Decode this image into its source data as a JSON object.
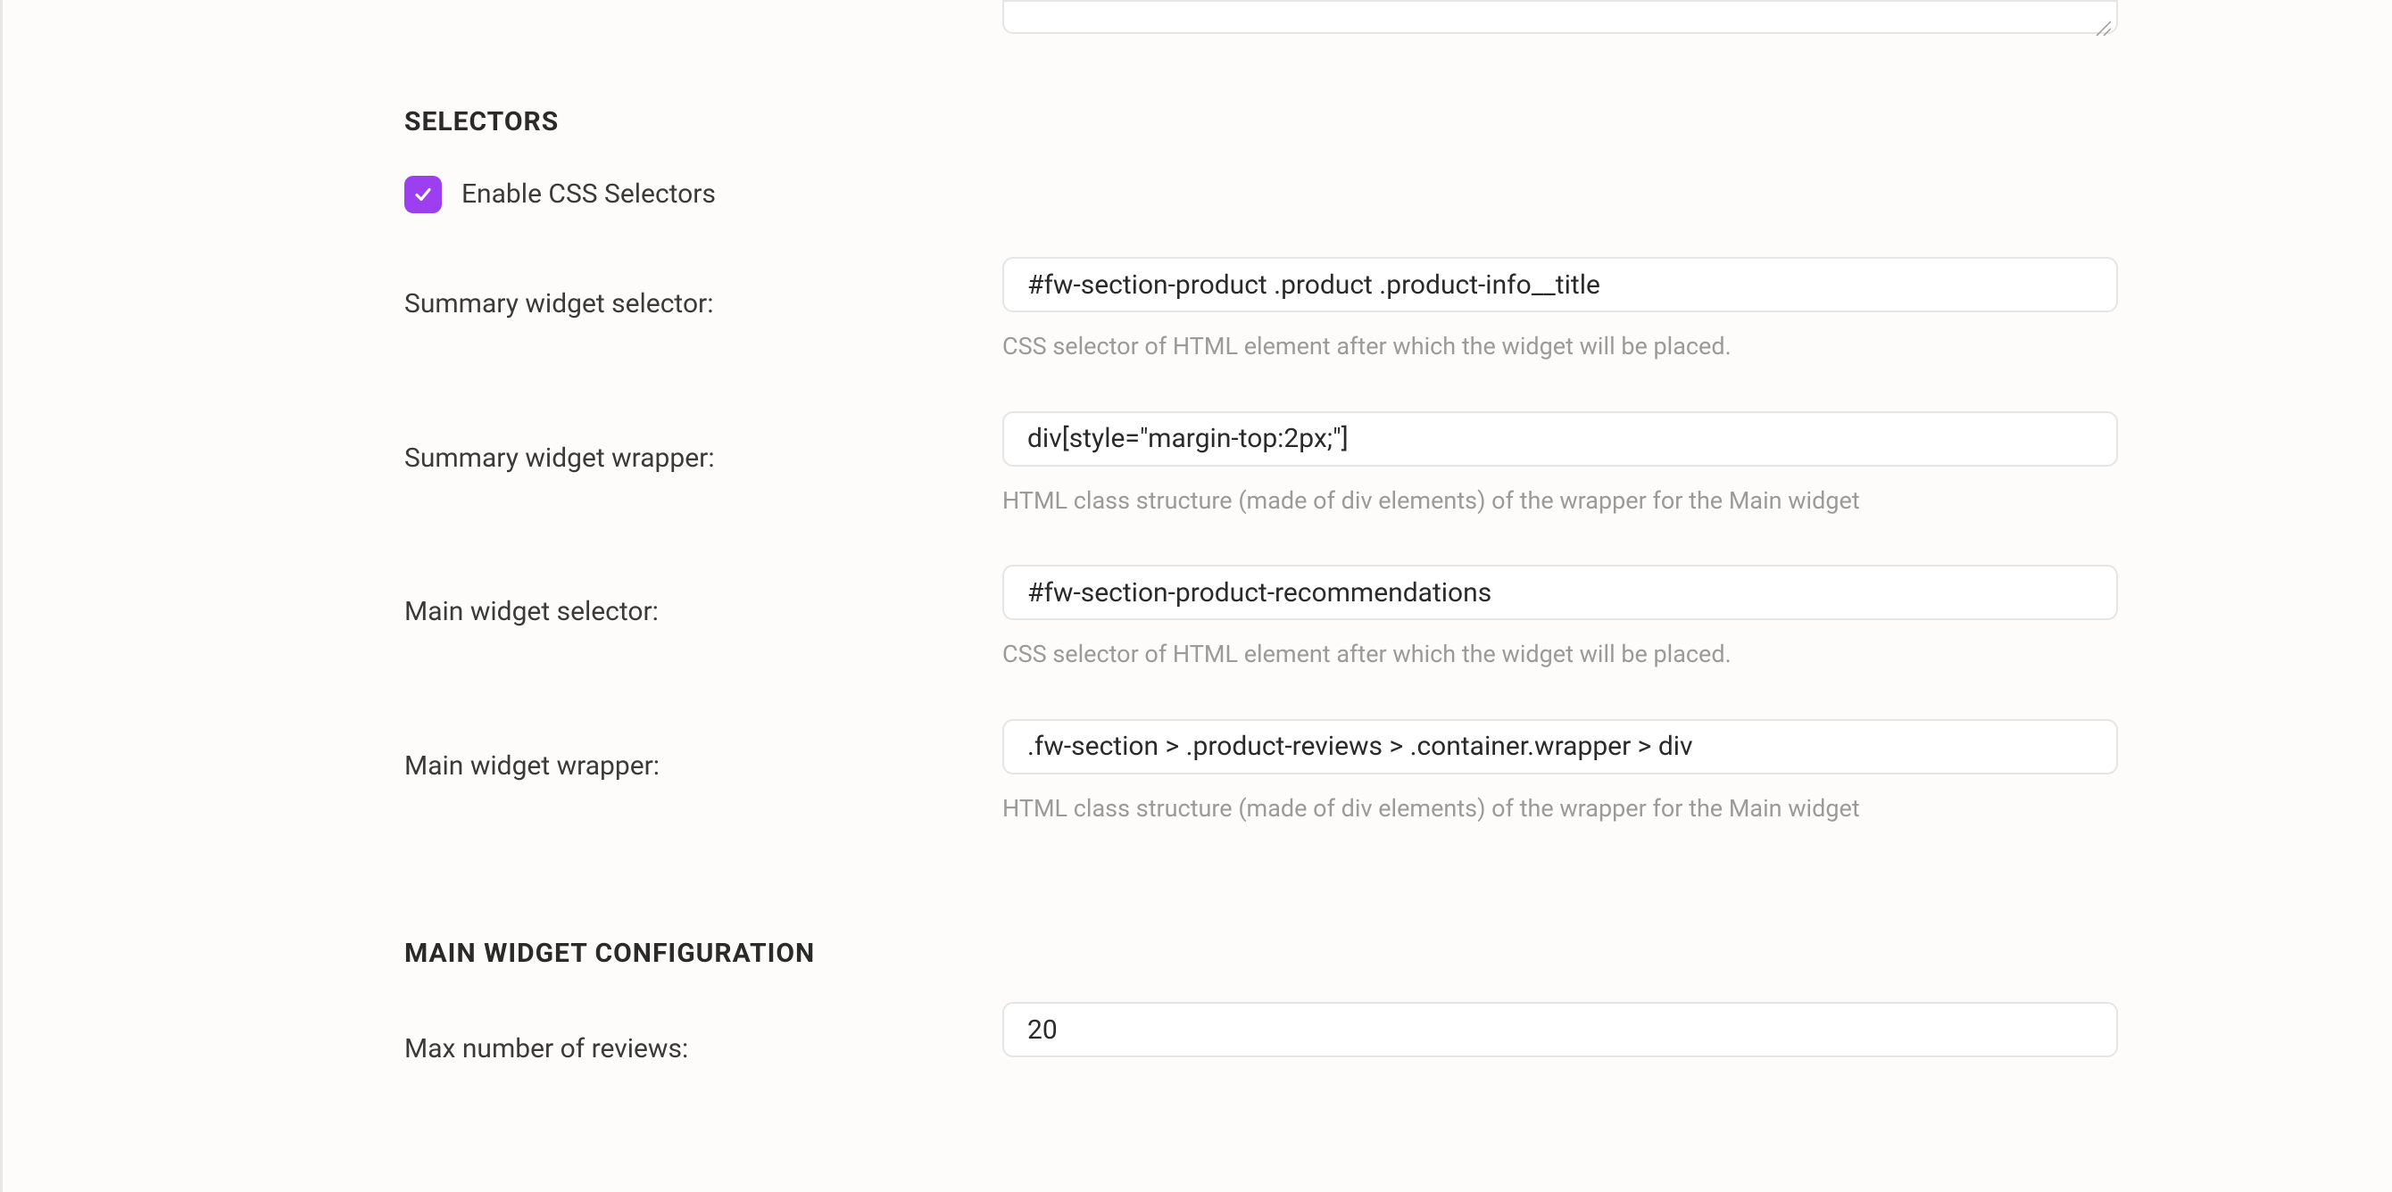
{
  "sections": {
    "selectors": {
      "heading": "SELECTORS",
      "enable_checkbox": {
        "label": "Enable CSS Selectors",
        "checked": true
      },
      "fields": {
        "summary_widget_selector": {
          "label": "Summary widget selector:",
          "value": "#fw-section-product .product .product-info__title",
          "help": "CSS selector of HTML element after which the widget will be placed."
        },
        "summary_widget_wrapper": {
          "label": "Summary widget wrapper:",
          "value": "div[style=\"margin-top:2px;\"]",
          "help": "HTML class structure (made of div elements) of the wrapper for the Main widget"
        },
        "main_widget_selector": {
          "label": "Main widget selector:",
          "value": "#fw-section-product-recommendations",
          "help": "CSS selector of HTML element after which the widget will be placed."
        },
        "main_widget_wrapper": {
          "label": "Main widget wrapper:",
          "value": ".fw-section > .product-reviews > .container.wrapper > div",
          "help": "HTML class structure (made of div elements) of the wrapper for the Main widget"
        }
      }
    },
    "main_widget_config": {
      "heading": "MAIN WIDGET CONFIGURATION",
      "fields": {
        "max_reviews": {
          "label": "Max number of reviews:",
          "value": "20"
        }
      }
    }
  },
  "colors": {
    "accent": "#9b3ff0",
    "background": "#fdfcfb",
    "border": "#e5e5e5",
    "text": "#2a2a2a",
    "help_text": "#9a9a9a"
  }
}
